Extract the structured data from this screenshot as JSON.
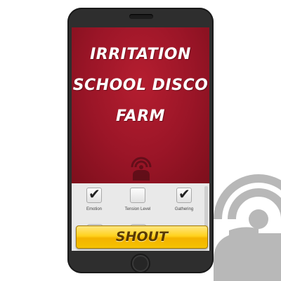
{
  "app": {
    "title_lines": [
      "IRRITATION",
      "SCHOOL DISCO",
      "FARM"
    ]
  },
  "options": [
    {
      "label": "Emotion",
      "checked": true
    },
    {
      "label": "Tension Level",
      "checked": false
    },
    {
      "label": "Gathering",
      "checked": true
    }
  ],
  "shout_button": {
    "label": "SHOUT"
  },
  "colors": {
    "hero_red": "#9a1527",
    "button_yellow": "#ffd21c",
    "phone_body": "#2e2e2e",
    "logo_gray": "#b8b8b8"
  },
  "icons": {
    "hero": "broadcast-icon",
    "background": "broadcast-logo-icon"
  }
}
